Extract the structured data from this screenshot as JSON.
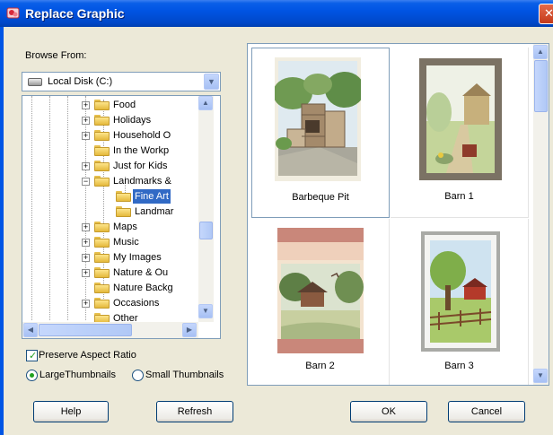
{
  "window": {
    "title": "Replace Graphic",
    "close_glyph": "✕"
  },
  "browse": {
    "label": "Browse From:",
    "location": "Local Disk (C:)"
  },
  "tree": {
    "items": [
      {
        "label": "Food",
        "expander": "+"
      },
      {
        "label": "Holidays",
        "expander": "+"
      },
      {
        "label": "Household O",
        "expander": "+"
      },
      {
        "label": "In the Workp",
        "expander": ""
      },
      {
        "label": "Just for Kids",
        "expander": "+"
      },
      {
        "label": "Landmarks &",
        "expander": "−"
      },
      {
        "label": "Fine Art",
        "expander": ""
      },
      {
        "label": "Landmar",
        "expander": ""
      },
      {
        "label": "Maps",
        "expander": "+"
      },
      {
        "label": "Music",
        "expander": "+"
      },
      {
        "label": "My Images",
        "expander": "+"
      },
      {
        "label": "Nature & Ou",
        "expander": "+"
      },
      {
        "label": "Nature Backg",
        "expander": ""
      },
      {
        "label": "Occasions",
        "expander": "+"
      },
      {
        "label": "Other",
        "expander": ""
      }
    ],
    "selected": "Fine Art"
  },
  "options": {
    "preserve_aspect_label": "Preserve Aspect Ratio",
    "preserve_aspect_checked": true,
    "large_thumbs_label": "LargeThumbnails",
    "small_thumbs_label": "Small Thumbnails",
    "selected_size": "LargeThumbnails"
  },
  "gallery": {
    "items": [
      {
        "caption": "Barbeque Pit",
        "selected": true
      },
      {
        "caption": "Barn 1",
        "selected": false
      },
      {
        "caption": "Barn 2",
        "selected": false
      },
      {
        "caption": "Barn 3",
        "selected": false
      }
    ]
  },
  "buttons": {
    "help": "Help",
    "refresh": "Refresh",
    "ok": "OK",
    "cancel": "Cancel"
  },
  "icons": {
    "app": "picture-icon",
    "drive": "hard-drive-icon",
    "folder": "folder-icon"
  },
  "colors": {
    "titlebar": "#0054e3",
    "dialog_bg": "#ece9d8",
    "selection": "#316ac5",
    "check": "#21a121"
  }
}
